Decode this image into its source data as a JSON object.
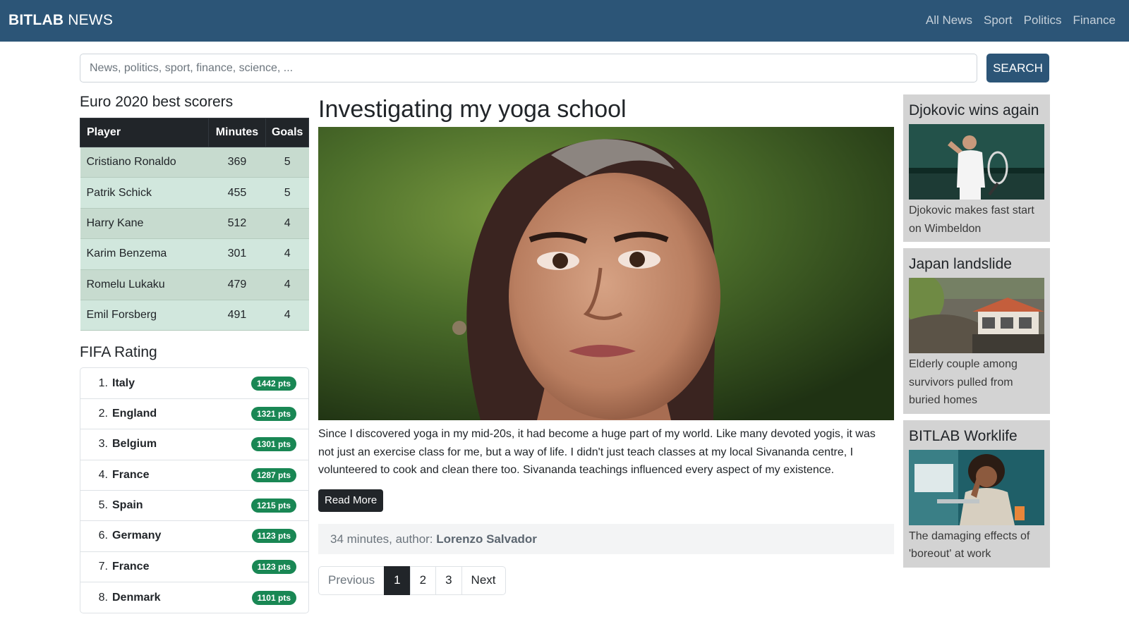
{
  "navbar": {
    "brand_bold": "BITLAB",
    "brand_rest": " NEWS",
    "links": [
      "All News",
      "Sport",
      "Politics",
      "Finance"
    ]
  },
  "search": {
    "placeholder": "News, politics, sport, finance, science, ...",
    "button_label": "SEARCH"
  },
  "scorers": {
    "title": "Euro 2020 best scorers",
    "headers": [
      "Player",
      "Minutes",
      "Goals"
    ],
    "rows": [
      {
        "player": "Cristiano Ronaldo",
        "minutes": "369",
        "goals": "5"
      },
      {
        "player": "Patrik Schick",
        "minutes": "455",
        "goals": "5"
      },
      {
        "player": "Harry Kane",
        "minutes": "512",
        "goals": "4"
      },
      {
        "player": "Karim Benzema",
        "minutes": "301",
        "goals": "4"
      },
      {
        "player": "Romelu Lukaku",
        "minutes": "479",
        "goals": "4"
      },
      {
        "player": "Emil Forsberg",
        "minutes": "491",
        "goals": "4"
      }
    ]
  },
  "fifa": {
    "title": "FIFA Rating",
    "items": [
      {
        "rank": "1.",
        "country": "Italy",
        "pts": "1442 pts"
      },
      {
        "rank": "2.",
        "country": "England",
        "pts": "1321 pts"
      },
      {
        "rank": "3.",
        "country": "Belgium",
        "pts": "1301 pts"
      },
      {
        "rank": "4.",
        "country": "France",
        "pts": "1287 pts"
      },
      {
        "rank": "5.",
        "country": "Spain",
        "pts": "1215 pts"
      },
      {
        "rank": "6.",
        "country": "Germany",
        "pts": "1123 pts"
      },
      {
        "rank": "7.",
        "country": "France",
        "pts": "1123 pts"
      },
      {
        "rank": "8.",
        "country": "Denmark",
        "pts": "1101 pts"
      }
    ],
    "badge_color": "#198754"
  },
  "article": {
    "title": "Investigating my yoga school",
    "body": "Since I discovered yoga in my mid-20s, it had become a huge part of my world. Like many devoted yogis, it was not just an exercise class for me, but a way of life. I didn't just teach classes at my local Sivananda centre, I volunteered to cook and clean there too. Sivananda teachings influenced every aspect of my existence.",
    "read_more": "Read More",
    "meta_prefix": "34 minutes, author: ",
    "author": "Lorenzo Salvador",
    "image_icon": "portrait-photo"
  },
  "pagination": {
    "previous": "Previous",
    "pages": [
      "1",
      "2",
      "3"
    ],
    "next": "Next",
    "active": "1"
  },
  "side_news": [
    {
      "title": "Djokovic wins again",
      "text": "Djokovic makes fast start on Wimbeldon",
      "image_icon": "tennis-photo"
    },
    {
      "title": "Japan landslide",
      "text": "Elderly couple among survivors pulled from buried homes",
      "image_icon": "landslide-photo"
    },
    {
      "title": "BITLAB Worklife",
      "text": "The damaging effects of 'boreout' at work",
      "image_icon": "office-worker-photo"
    }
  ],
  "colors": {
    "navbar": "#2c5577",
    "table_header": "#212529",
    "card_bg": "#d3d3d3"
  }
}
